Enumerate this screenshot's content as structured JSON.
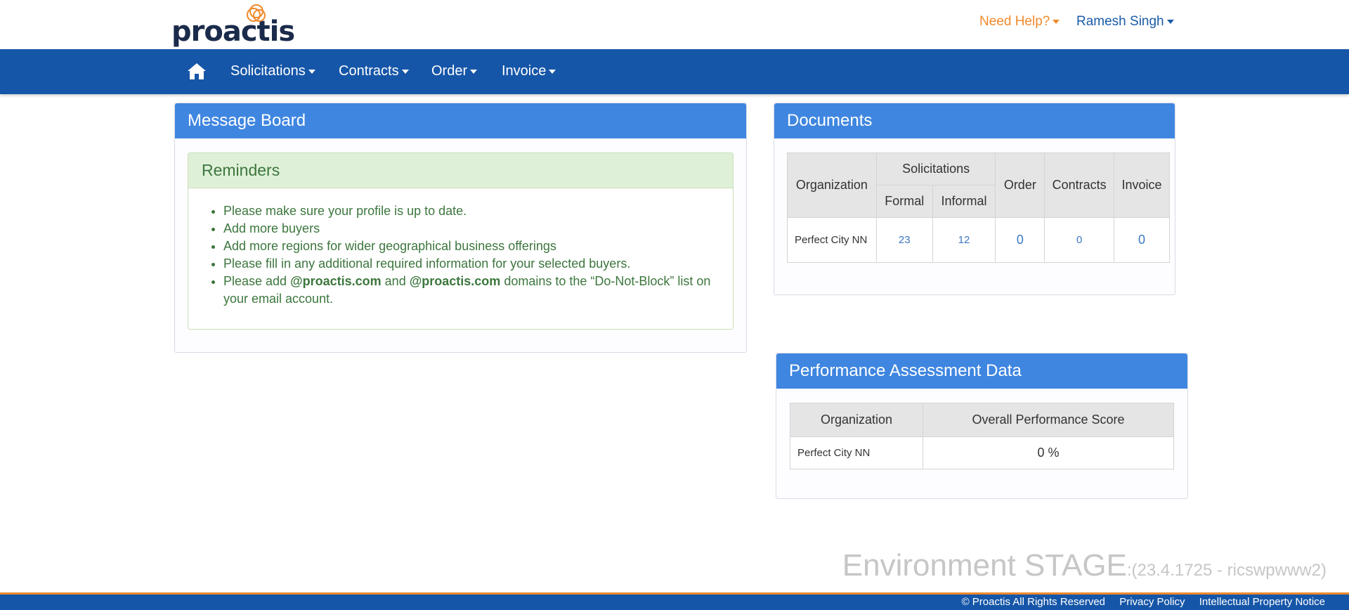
{
  "header": {
    "logo_text": "proactis",
    "help_label": "Need Help?",
    "user_name": "Ramesh Singh",
    "colors": {
      "brand_orange": "#f08a2c",
      "brand_blue": "#1656a8",
      "panel_blue": "#3f86e0"
    }
  },
  "nav": {
    "home_icon": "home-icon",
    "items": [
      {
        "label": "Solicitations"
      },
      {
        "label": "Contracts"
      },
      {
        "label": "Order"
      },
      {
        "label": "Invoice"
      }
    ]
  },
  "message_board": {
    "title": "Message Board",
    "reminders": {
      "title": "Reminders",
      "items": [
        "Please make sure your profile is up to date.",
        "Add more buyers",
        "Add more regions for wider geographical business offerings",
        "Please fill in any additional required information for your selected buyers."
      ],
      "domain_item": {
        "prefix": "Please add ",
        "domain1": "@proactis.com",
        "middle": " and ",
        "domain2": "@proactis.com",
        "suffix": " domains to the “Do-Not-Block” list on your email account."
      }
    }
  },
  "documents": {
    "title": "Documents",
    "headers": {
      "organization": "Organization",
      "solicitations": "Solicitations",
      "formal": "Formal",
      "informal": "Informal",
      "order": "Order",
      "contracts": "Contracts",
      "invoice": "Invoice"
    },
    "row": {
      "organization": "Perfect City NN",
      "formal": "23",
      "informal": "12",
      "order": "0",
      "contracts": "0",
      "invoice": "0"
    }
  },
  "performance": {
    "title": "Performance Assessment Data",
    "headers": {
      "organization": "Organization",
      "score": "Overall Performance Score"
    },
    "row": {
      "organization": "Perfect City NN",
      "score": "0 %"
    }
  },
  "environment": {
    "label": "Environment STAGE",
    "version": ":(23.4.1725 - ricswpwww2)"
  },
  "footer": {
    "copyright": "© Proactis All Rights Reserved",
    "privacy": "Privacy Policy",
    "ip_notice": "Intellectual Property Notice"
  }
}
